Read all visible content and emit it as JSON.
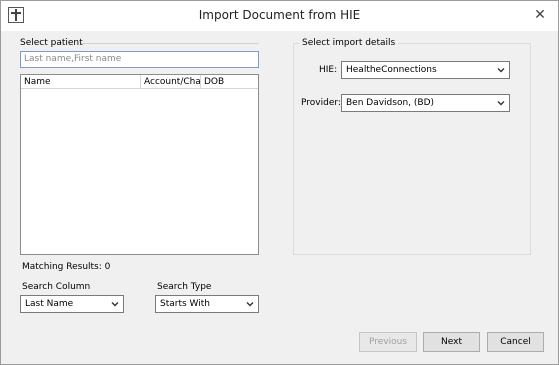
{
  "window": {
    "title": "Import Document from HIE",
    "close_glyph": "✕",
    "app_icon": "hie-cross-icon"
  },
  "patient": {
    "group_label": "Select patient",
    "search_placeholder": "Last name,First name",
    "columns": [
      "Name",
      "Account/Cha",
      "DOB"
    ],
    "rows": [],
    "matching_results": "Matching Results: 0",
    "search_column_label": "Search Column",
    "search_column_value": "Last Name",
    "search_type_label": "Search Type",
    "search_type_value": "Starts With"
  },
  "import": {
    "group_label": "Select import details",
    "hie_label": "HIE:",
    "hie_value": "HealtheConnections",
    "provider_label": "Provider:",
    "provider_value": "Ben Davidson,  (BD)"
  },
  "footer": {
    "previous_label": "Previous",
    "next_label": "Next",
    "cancel_label": "Cancel"
  }
}
